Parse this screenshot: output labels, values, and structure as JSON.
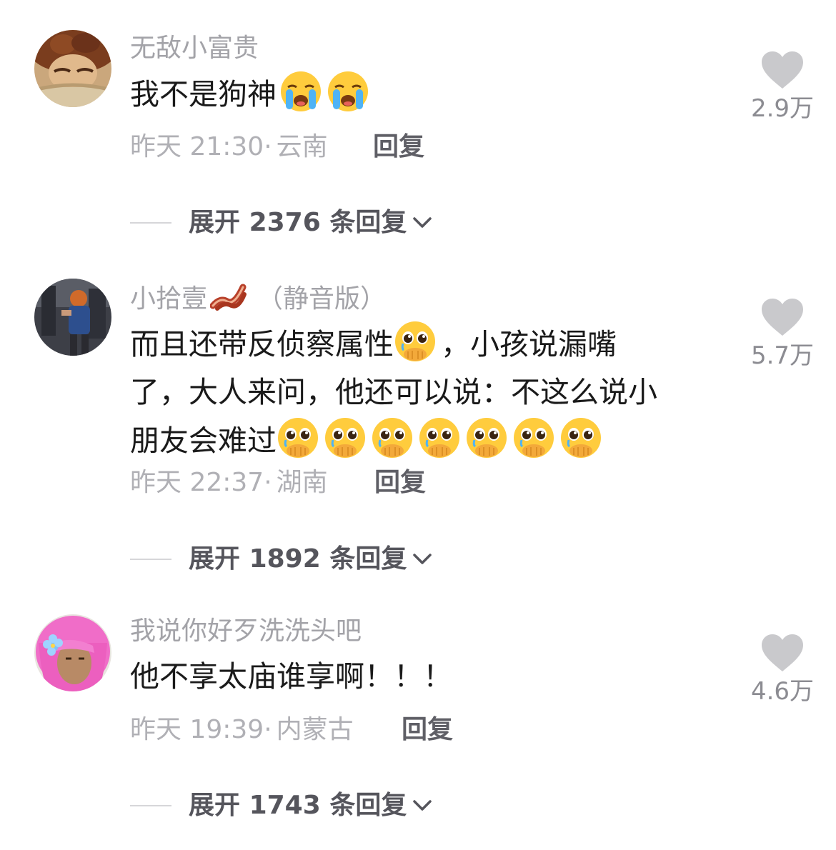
{
  "comments": [
    {
      "username": "无敌小富贵",
      "username_suffix": "",
      "text_lines": [
        {
          "text": "我不是狗神",
          "emojis": [
            "loudly-crying",
            "loudly-crying"
          ]
        }
      ],
      "time": "昨天 21:30·",
      "location": "云南",
      "reply_label": "回复",
      "likes": "2.9万",
      "expand_prefix": "展开",
      "expand_count": "2376",
      "expand_suffix": "条回复"
    },
    {
      "username": "小拾壹",
      "username_emoji": "bacon",
      "username_suffix": "（静音版）",
      "text_lines": [
        {
          "text": "而且还带反侦察属性",
          "emojis": [
            "pleading-hands"
          ],
          "after": "，小孩说漏嘴"
        },
        {
          "text": "了，大人来问，他还可以说：不这么说小"
        },
        {
          "text": "朋友会难过",
          "emojis": [
            "pleading-hands",
            "pleading-hands",
            "pleading-hands",
            "pleading-hands",
            "pleading-hands",
            "pleading-hands",
            "pleading-hands"
          ]
        }
      ],
      "time": "昨天 22:37·",
      "location": "湖南",
      "reply_label": "回复",
      "likes": "5.7万",
      "expand_prefix": "展开",
      "expand_count": "1892",
      "expand_suffix": "条回复"
    },
    {
      "username": "我说你好歹洗洗头吧",
      "username_suffix": "",
      "text_lines": [
        {
          "text": "他不享太庙谁享啊！！！"
        }
      ],
      "time": "昨天 19:39·",
      "location": "内蒙古",
      "reply_label": "回复",
      "likes": "4.6万",
      "expand_prefix": "展开",
      "expand_count": "1743",
      "expand_suffix": "条回复"
    }
  ],
  "colors": {
    "username": "#a3a3a8",
    "body": "#1a1a1a",
    "meta": "#b0b0b5",
    "reply": "#5f5f66",
    "heart": "#c9c9cc",
    "likes": "#8c8c92",
    "expand": "#55555c",
    "expand_line": "#d6d6d9"
  },
  "icons": {
    "heart": "heart-icon",
    "chevron": "chevron-down-icon",
    "emoji_crying": "loudly-crying-face-icon",
    "emoji_pleading": "pleading-face-with-hands-icon",
    "emoji_bacon": "bacon-icon"
  }
}
